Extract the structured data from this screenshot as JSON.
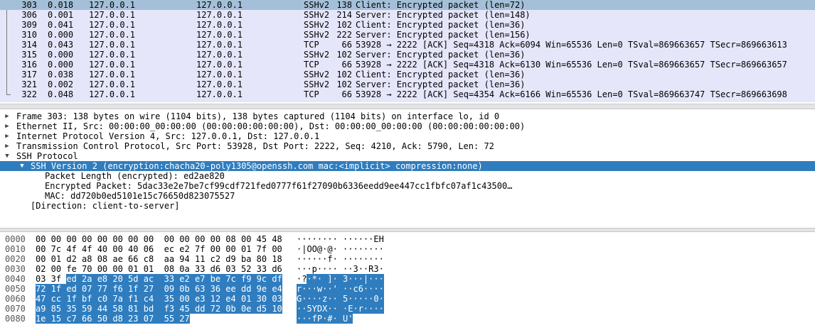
{
  "packets": [
    {
      "no": "303",
      "time": "0.018",
      "src": "127.0.0.1",
      "dst": "127.0.0.1",
      "proto": "SSHv2",
      "len": "138",
      "info": "Client: Encrypted packet (len=72)",
      "selected": true
    },
    {
      "no": "306",
      "time": "0.001",
      "src": "127.0.0.1",
      "dst": "127.0.0.1",
      "proto": "SSHv2",
      "len": "214",
      "info": "Server: Encrypted packet (len=148)"
    },
    {
      "no": "309",
      "time": "0.041",
      "src": "127.0.0.1",
      "dst": "127.0.0.1",
      "proto": "SSHv2",
      "len": "102",
      "info": "Client: Encrypted packet (len=36)"
    },
    {
      "no": "310",
      "time": "0.000",
      "src": "127.0.0.1",
      "dst": "127.0.0.1",
      "proto": "SSHv2",
      "len": "222",
      "info": "Server: Encrypted packet (len=156)"
    },
    {
      "no": "314",
      "time": "0.043",
      "src": "127.0.0.1",
      "dst": "127.0.0.1",
      "proto": "TCP",
      "len": "66",
      "info": "53928 → 2222 [ACK] Seq=4318 Ack=6094 Win=65536 Len=0 TSval=869663657 TSecr=869663613"
    },
    {
      "no": "315",
      "time": "0.000",
      "src": "127.0.0.1",
      "dst": "127.0.0.1",
      "proto": "SSHv2",
      "len": "102",
      "info": "Server: Encrypted packet (len=36)"
    },
    {
      "no": "316",
      "time": "0.000",
      "src": "127.0.0.1",
      "dst": "127.0.0.1",
      "proto": "TCP",
      "len": "66",
      "info": "53928 → 2222 [ACK] Seq=4318 Ack=6130 Win=65536 Len=0 TSval=869663657 TSecr=869663657"
    },
    {
      "no": "317",
      "time": "0.038",
      "src": "127.0.0.1",
      "dst": "127.0.0.1",
      "proto": "SSHv2",
      "len": "102",
      "info": "Client: Encrypted packet (len=36)"
    },
    {
      "no": "321",
      "time": "0.002",
      "src": "127.0.0.1",
      "dst": "127.0.0.1",
      "proto": "SSHv2",
      "len": "102",
      "info": "Server: Encrypted packet (len=36)"
    },
    {
      "no": "322",
      "time": "0.048",
      "src": "127.0.0.1",
      "dst": "127.0.0.1",
      "proto": "TCP",
      "len": "66",
      "info": "53928 → 2222 [ACK] Seq=4354 Ack=6166 Win=65536 Len=0 TSval=869663747 TSecr=869663698"
    }
  ],
  "details": [
    {
      "level": 0,
      "arrow": "collapsed",
      "text": "Frame 303: 138 bytes on wire (1104 bits), 138 bytes captured (1104 bits) on interface lo, id 0"
    },
    {
      "level": 0,
      "arrow": "collapsed",
      "text": "Ethernet II, Src: 00:00:00_00:00:00 (00:00:00:00:00:00), Dst: 00:00:00_00:00:00 (00:00:00:00:00:00)"
    },
    {
      "level": 0,
      "arrow": "collapsed",
      "text": "Internet Protocol Version 4, Src: 127.0.0.1, Dst: 127.0.0.1"
    },
    {
      "level": 0,
      "arrow": "collapsed",
      "text": "Transmission Control Protocol, Src Port: 53928, Dst Port: 2222, Seq: 4210, Ack: 5790, Len: 72"
    },
    {
      "level": 0,
      "arrow": "expanded",
      "text": "SSH Protocol"
    },
    {
      "level": 1,
      "arrow": "expanded",
      "text": "SSH Version 2 (encryption:chacha20-poly1305@openssh.com mac:<implicit> compression:none)",
      "selected": true
    },
    {
      "level": 2,
      "arrow": "none",
      "text": "Packet Length (encrypted): ed2ae820"
    },
    {
      "level": 2,
      "arrow": "none",
      "text": "Encrypted Packet: 5dac33e2e7be7cf99cdf721fed0777f61f27090b6336eedd9ee447cc1fbfc07af1c43500…"
    },
    {
      "level": 2,
      "arrow": "none",
      "text": "MAC: dd720b0ed5101e15c76650d823075527"
    },
    {
      "level": 1,
      "arrow": "none",
      "text": "[Direction: client-to-server]"
    }
  ],
  "hex": [
    {
      "offset": "0000",
      "bytes": "00 00 00 00 00 00 00 00  00 00 00 00 08 00 45 48",
      "ascii": "········ ······EH",
      "hl_from": -1
    },
    {
      "offset": "0010",
      "bytes": "00 7c 4f 4f 40 00 40 06  ec e2 7f 00 00 01 7f 00",
      "ascii": "·|OO@·@· ········",
      "hl_from": -1
    },
    {
      "offset": "0020",
      "bytes": "00 01 d2 a8 08 ae 66 c8  aa 94 11 c2 d9 ba 80 18",
      "ascii": "······f· ········",
      "hl_from": -1
    },
    {
      "offset": "0030",
      "bytes": "02 00 fe 70 00 00 01 01  08 0a 33 d6 03 52 33 d6",
      "ascii": "···p···· ··3··R3·",
      "hl_from": -1
    },
    {
      "offset": "0040",
      "bytes": "03 3f ed 2a e8 20 5d ac  33 e2 e7 be 7c f9 9c df",
      "ascii": "·?·*· ]· 3···|···",
      "hl_from": 2
    },
    {
      "offset": "0050",
      "bytes": "72 1f ed 07 77 f6 1f 27  09 0b 63 36 ee dd 9e e4",
      "ascii": "r···w··' ··c6····",
      "hl_from": 0
    },
    {
      "offset": "0060",
      "bytes": "47 cc 1f bf c0 7a f1 c4  35 00 e3 12 e4 01 30 03",
      "ascii": "G····z·· 5·····0·",
      "hl_from": 0
    },
    {
      "offset": "0070",
      "bytes": "a9 85 35 59 44 58 81 bd  f3 45 dd 72 0b 0e d5 10",
      "ascii": "··5YDX·· ·E·r····",
      "hl_from": 0
    },
    {
      "offset": "0080",
      "bytes": "1e 15 c7 66 50 d8 23 07  55 27",
      "ascii": "···fP·#· U'",
      "hl_from": 0
    }
  ]
}
